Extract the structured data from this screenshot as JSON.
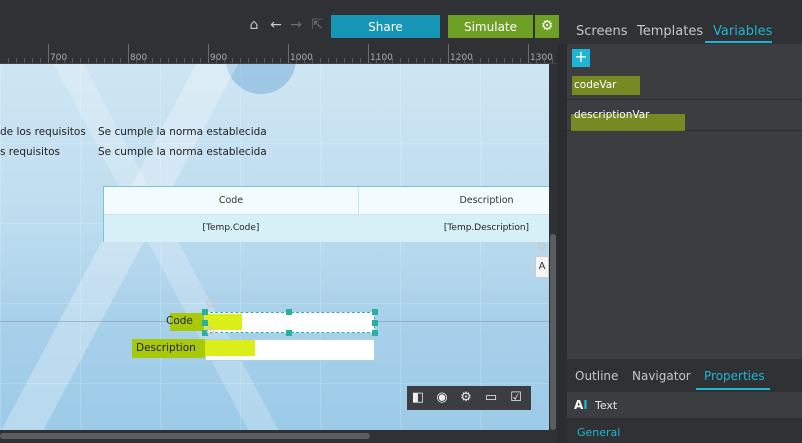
{
  "toolbar": {
    "share_label": "Share",
    "simulate_label": "Simulate",
    "icons": [
      "home-icon",
      "back-arrow-icon",
      "forward-arrow-icon",
      "exit-fullscreen-icon",
      "gear-icon"
    ]
  },
  "right_tabs": {
    "screens": "Screens",
    "templates": "Templates",
    "variables": "Variables",
    "active": "Variables"
  },
  "ruler": {
    "labels": [
      "700",
      "800",
      "900",
      "1000",
      "1100",
      "1200",
      "1300"
    ]
  },
  "canvas": {
    "req_line1_left": "de los requisitos",
    "req_line1_right": "Se cumple la norma establecida",
    "req_line2_left": "s requisitos",
    "req_line2_right": "Se cumple la norma establecida",
    "table": {
      "headers": [
        "Code",
        "Description"
      ],
      "row": [
        "[Temp.Code]",
        "[Temp.Description]"
      ]
    },
    "code_label": "Code",
    "description_label": "Description",
    "side_letter": "A"
  },
  "variables": {
    "add_icon": "plus-icon",
    "items": [
      "codeVar",
      "descriptionVar"
    ]
  },
  "bottom_tabs": {
    "outline": "Outline",
    "navigator": "Navigator",
    "properties": "Properties",
    "active": "Properties"
  },
  "properties": {
    "type_label": "Text",
    "section": "General"
  },
  "colors": {
    "accent": "#1fb4d4",
    "share": "#1695b7",
    "simulate": "#6ea025",
    "highlight": "#dbee1a"
  }
}
